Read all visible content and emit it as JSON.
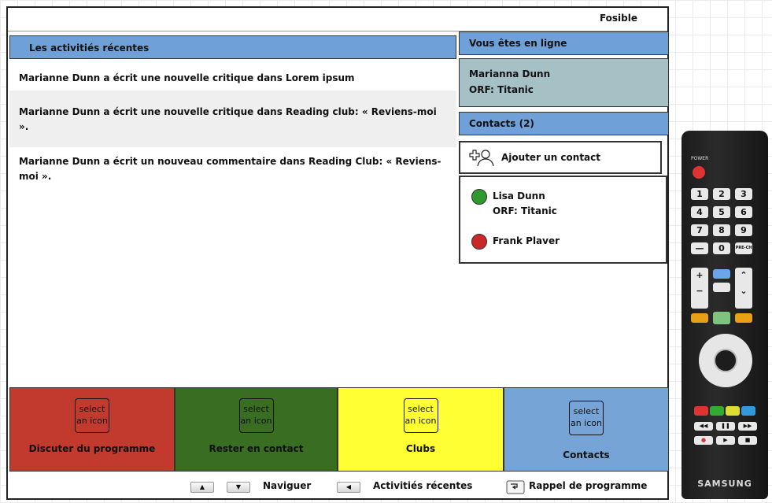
{
  "brand": "Fosible",
  "activities": {
    "header": "Les activitiés récentes",
    "items": [
      "Marianne Dunn a écrit une nouvelle critique dans Lorem ipsum",
      "Marianne Dunn a écrit une nouvelle critique dans Reading club: « Reviens-moi ».",
      "Marianne  Dunn a écrit un nouveau commentaire dans Reading Club: « Reviens-moi »."
    ]
  },
  "online": {
    "header": "Vous êtes en ligne",
    "user": "Marianna Dunn",
    "program": "ORF: Titanic"
  },
  "contacts": {
    "header": "Contacts (2)",
    "add_label": "Ajouter un contact",
    "items": [
      {
        "name": "Lisa Dunn",
        "program": "ORF: Titanic",
        "status_color": "#2e9a2e"
      },
      {
        "name": "Frank Plaver",
        "program": "",
        "status_color": "#c8282a"
      }
    ]
  },
  "tiles": [
    {
      "icon_text": "select an icon",
      "label": "Discuter du programme",
      "color": "#c23a2e"
    },
    {
      "icon_text": "select an icon",
      "label": "Rester en contact",
      "color": "#386d22"
    },
    {
      "icon_text": "select an icon",
      "label": "Clubs",
      "color": "#ffff33"
    },
    {
      "icon_text": "select an icon",
      "label": "Contacts",
      "color": "#76a4d6"
    }
  ],
  "footer": {
    "navigate": "Naviguer",
    "recent": "Activitiés récentes",
    "recall": "Rappel de programme"
  },
  "remote": {
    "power": "POWER",
    "digits": [
      "1",
      "2",
      "3",
      "4",
      "5",
      "6",
      "7",
      "8",
      "9",
      "—",
      "0",
      "PRE-CH"
    ],
    "brand": "SAMSUNG"
  }
}
